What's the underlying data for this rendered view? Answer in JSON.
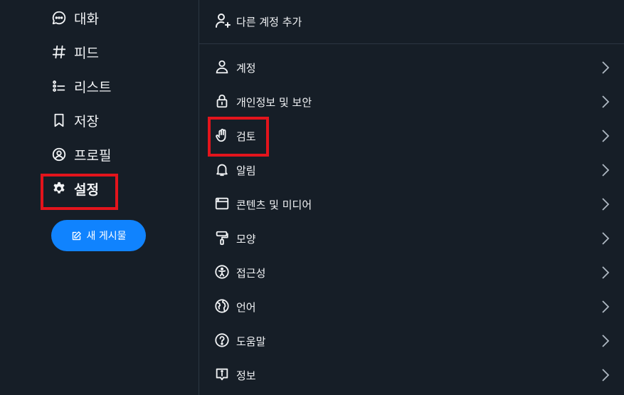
{
  "nav": {
    "items": [
      {
        "label": "대화",
        "icon": "chat-bubble-icon"
      },
      {
        "label": "피드",
        "icon": "hash-icon"
      },
      {
        "label": "리스트",
        "icon": "list-icon"
      },
      {
        "label": "저장",
        "icon": "bookmark-icon"
      },
      {
        "label": "프로필",
        "icon": "profile-icon"
      },
      {
        "label": "설정",
        "icon": "gear-icon",
        "active": true
      }
    ],
    "new_post_label": "새 게시물"
  },
  "settings": {
    "add_account_label": "다른 계정 추가",
    "items": [
      {
        "label": "계정",
        "icon": "person-icon"
      },
      {
        "label": "개인정보 및 보안",
        "icon": "lock-icon"
      },
      {
        "label": "검토",
        "icon": "hand-icon"
      },
      {
        "label": "알림",
        "icon": "bell-icon"
      },
      {
        "label": "콘텐츠 및 미디어",
        "icon": "window-icon"
      },
      {
        "label": "모양",
        "icon": "paint-roller-icon"
      },
      {
        "label": "접근성",
        "icon": "accessibility-icon"
      },
      {
        "label": "언어",
        "icon": "globe-icon"
      },
      {
        "label": "도움말",
        "icon": "question-icon"
      },
      {
        "label": "정보",
        "icon": "info-icon"
      }
    ]
  },
  "colors": {
    "background": "#161e27",
    "accent": "#1083fe",
    "highlight": "#e3141c",
    "text": "#f1f3f5"
  }
}
